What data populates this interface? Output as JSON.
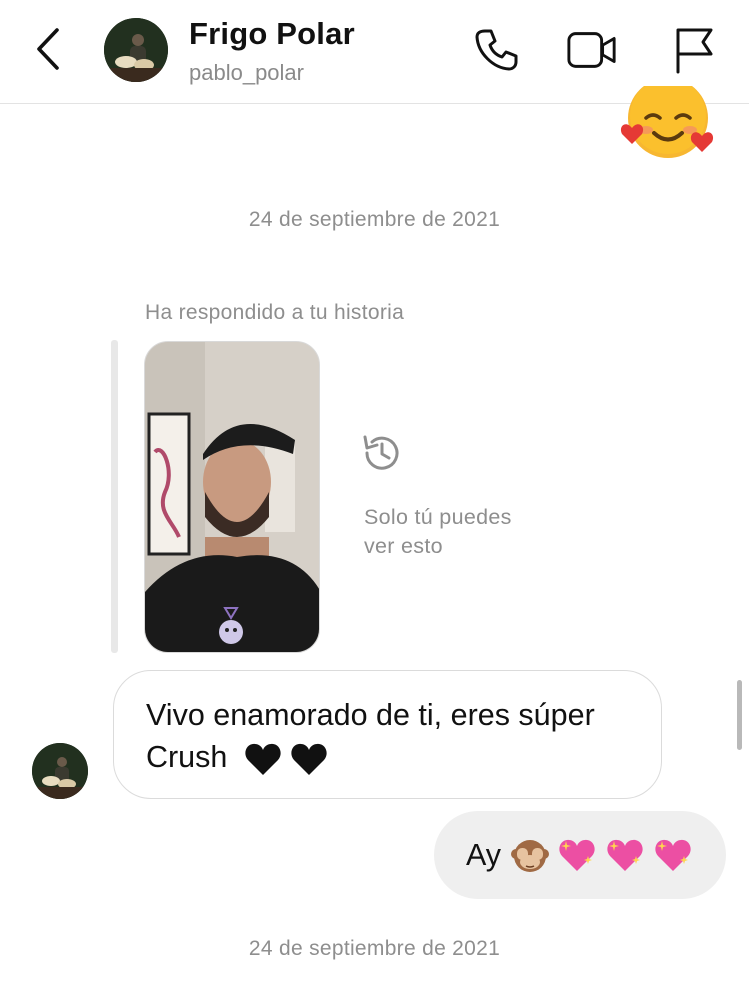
{
  "header": {
    "title": "Frigo Polar",
    "username": "pablo_polar",
    "icons": [
      "back-chevron-icon",
      "phone-icon",
      "video-camera-icon",
      "flag-icon"
    ]
  },
  "messages": {
    "date_1": "24 de septiembre de 2021",
    "story_reply_label": "Ha respondido a tu historia",
    "story_notice": [
      "Solo tú puedes",
      "ver esto"
    ],
    "incoming_text_line1": "Vivo enamorado de ti, eres súper",
    "incoming_text_line2": "Crush",
    "outgoing_text": "Ay",
    "date_2": "24 de septiembre de 2021"
  },
  "colors": {
    "muted_text": "#8e8e8e",
    "outgoing_bubble": "#efefef",
    "incoming_border": "#dbdbdb"
  }
}
